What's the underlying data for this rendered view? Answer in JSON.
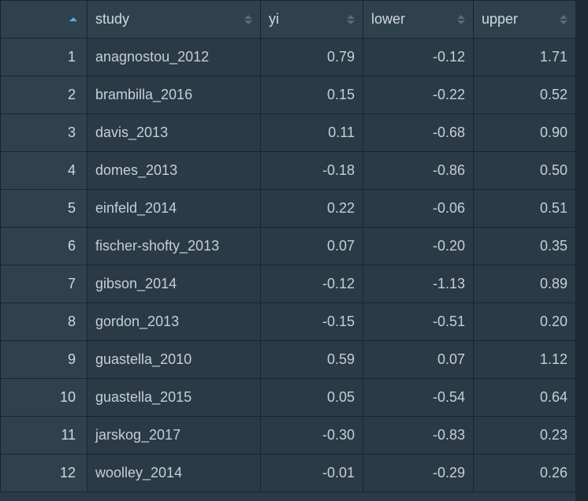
{
  "columns": {
    "study": "study",
    "yi": "yi",
    "lower": "lower",
    "upper": "upper"
  },
  "rows": [
    {
      "n": "1",
      "study": "anagnostou_2012",
      "yi": "0.79",
      "lower": "-0.12",
      "upper": "1.71"
    },
    {
      "n": "2",
      "study": "brambilla_2016",
      "yi": "0.15",
      "lower": "-0.22",
      "upper": "0.52"
    },
    {
      "n": "3",
      "study": "davis_2013",
      "yi": "0.11",
      "lower": "-0.68",
      "upper": "0.90"
    },
    {
      "n": "4",
      "study": "domes_2013",
      "yi": "-0.18",
      "lower": "-0.86",
      "upper": "0.50"
    },
    {
      "n": "5",
      "study": "einfeld_2014",
      "yi": "0.22",
      "lower": "-0.06",
      "upper": "0.51"
    },
    {
      "n": "6",
      "study": "fischer-shofty_2013",
      "yi": "0.07",
      "lower": "-0.20",
      "upper": "0.35"
    },
    {
      "n": "7",
      "study": "gibson_2014",
      "yi": "-0.12",
      "lower": "-1.13",
      "upper": "0.89"
    },
    {
      "n": "8",
      "study": "gordon_2013",
      "yi": "-0.15",
      "lower": "-0.51",
      "upper": "0.20"
    },
    {
      "n": "9",
      "study": "guastella_2010",
      "yi": "0.59",
      "lower": "0.07",
      "upper": "1.12"
    },
    {
      "n": "10",
      "study": "guastella_2015",
      "yi": "0.05",
      "lower": "-0.54",
      "upper": "0.64"
    },
    {
      "n": "11",
      "study": "jarskog_2017",
      "yi": "-0.30",
      "lower": "-0.83",
      "upper": "0.23"
    },
    {
      "n": "12",
      "study": "woolley_2014",
      "yi": "-0.01",
      "lower": "-0.29",
      "upper": "0.26"
    }
  ]
}
